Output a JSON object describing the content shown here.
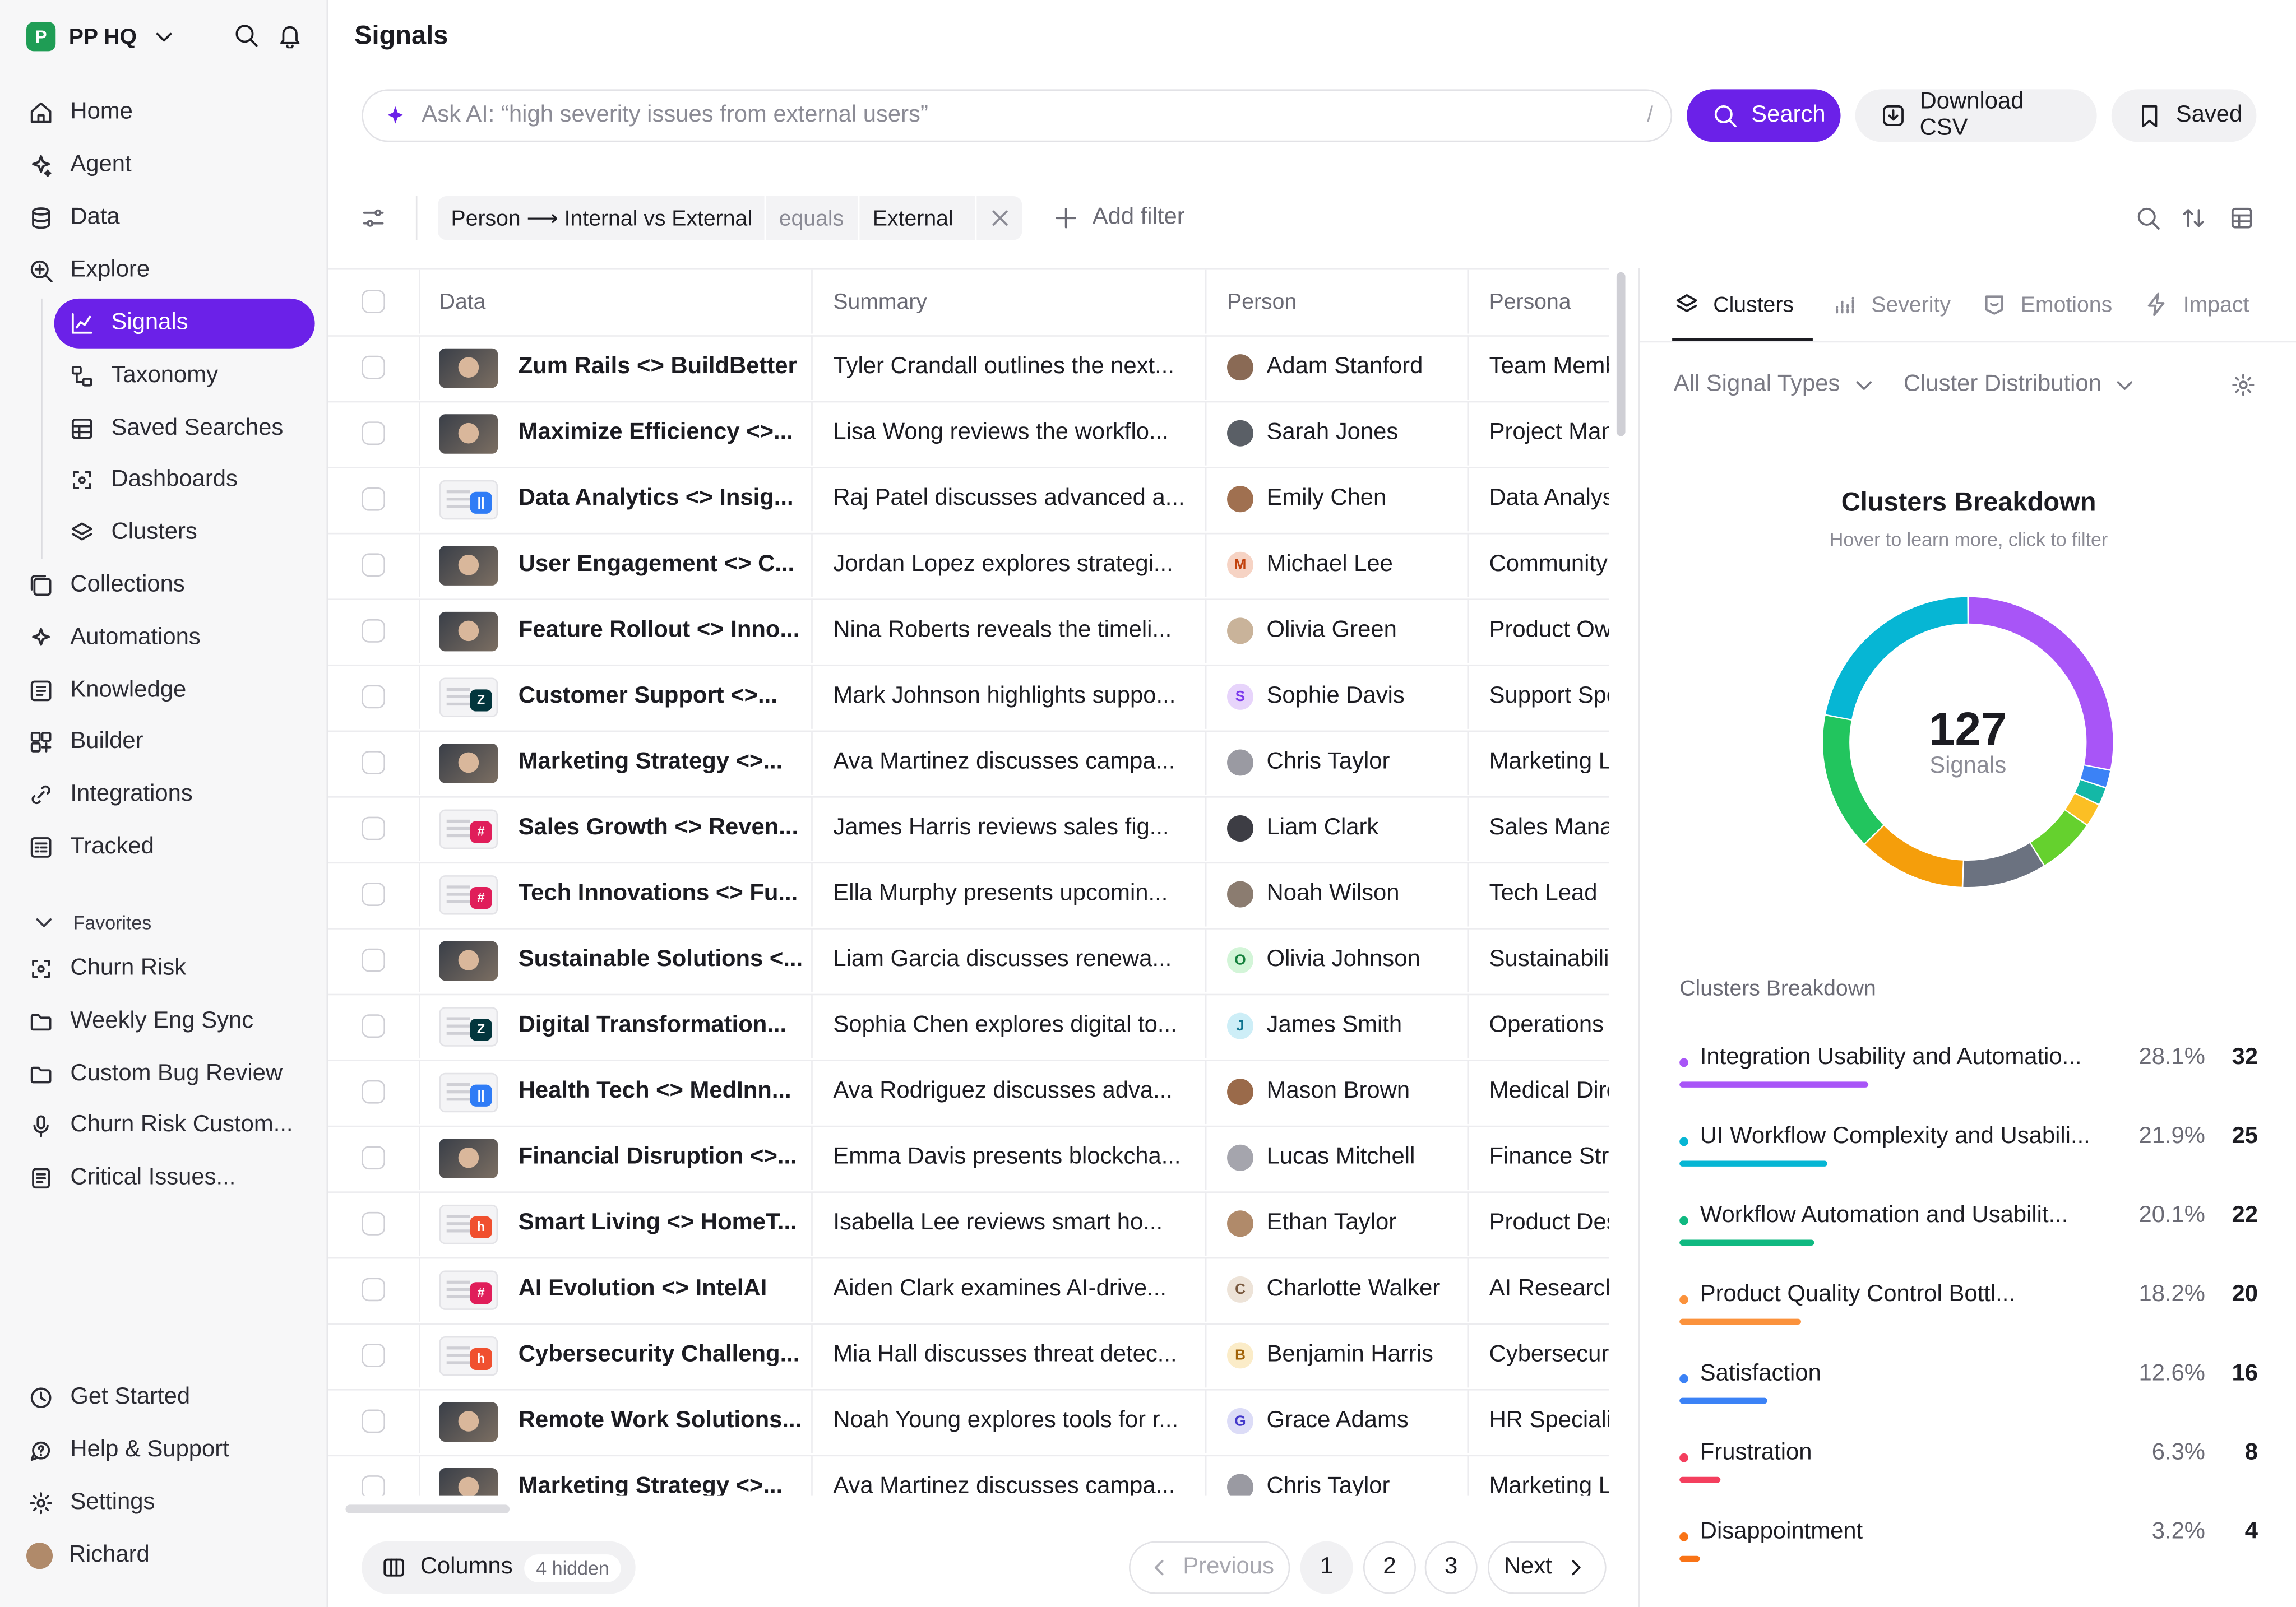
{
  "workspace": {
    "name": "PP HQ",
    "logo_letter": "P"
  },
  "nav": {
    "items": [
      {
        "label": "Home",
        "icon": "home-icon"
      },
      {
        "label": "Agent",
        "icon": "sparkle-icon"
      },
      {
        "label": "Data",
        "icon": "database-icon"
      },
      {
        "label": "Explore",
        "icon": "explore-icon"
      }
    ],
    "sub_items": [
      {
        "label": "Signals",
        "icon": "chart-icon",
        "active": true
      },
      {
        "label": "Taxonomy",
        "icon": "taxonomy-icon"
      },
      {
        "label": "Saved Searches",
        "icon": "table-icon"
      },
      {
        "label": "Dashboards",
        "icon": "dashboard-icon"
      },
      {
        "label": "Clusters",
        "icon": "layers-icon"
      }
    ],
    "items2": [
      {
        "label": "Collections",
        "icon": "collections-icon"
      },
      {
        "label": "Automations",
        "icon": "automation-icon"
      },
      {
        "label": "Knowledge",
        "icon": "knowledge-icon"
      },
      {
        "label": "Builder",
        "icon": "builder-icon"
      },
      {
        "label": "Integrations",
        "icon": "integrations-icon"
      },
      {
        "label": "Tracked",
        "icon": "tracked-icon"
      }
    ],
    "favorites_label": "Favorites",
    "favorites": [
      {
        "label": "Churn Risk",
        "icon": "dashboard-icon"
      },
      {
        "label": "Weekly Eng Sync",
        "icon": "folder-icon"
      },
      {
        "label": "Custom Bug Review",
        "icon": "folder-icon"
      },
      {
        "label": "Churn Risk Custom...",
        "icon": "mic-icon"
      },
      {
        "label": "Critical Issues...",
        "icon": "document-icon"
      }
    ],
    "bottom": [
      {
        "label": "Get Started",
        "icon": "clock-icon"
      },
      {
        "label": "Help & Support",
        "icon": "help-icon"
      },
      {
        "label": "Settings",
        "icon": "gear-icon"
      }
    ],
    "user": "Richard"
  },
  "page": {
    "title": "Signals"
  },
  "search": {
    "placeholder": "Ask AI: “high severity issues from external users”",
    "shortcut": "/",
    "search_label": "Search",
    "download_label": "Download CSV",
    "saved_label": "Saved"
  },
  "filter": {
    "field": "Person ⟶ Internal vs External",
    "operator": "equals",
    "value": "External",
    "add_label": "Add filter"
  },
  "table": {
    "headers": {
      "data": "Data",
      "summary": "Summary",
      "person": "Person",
      "persona": "Persona"
    },
    "rows": [
      {
        "data": "Zum Rails <> BuildBetter",
        "summary": "Tyler Crandall outlines the next...",
        "person": "Adam Stanford",
        "persona": "Team Member",
        "thumb": "video",
        "av": "photo",
        "avc": "#8a6a55",
        "avl": ""
      },
      {
        "data": "Maximize Efficiency <>...",
        "summary": "Lisa Wong reviews the workflo...",
        "person": "Sarah Jones",
        "persona": "Project Manager",
        "thumb": "video",
        "av": "photo",
        "avc": "#5a5f66",
        "avl": ""
      },
      {
        "data": "Data Analytics <> Insig...",
        "summary": "Raj Patel discusses advanced a...",
        "person": "Emily Chen",
        "persona": "Data Analyst",
        "thumb": "doc",
        "tb": "||",
        "tbc": "#2f7cf6",
        "av": "photo",
        "avc": "#a07050",
        "avl": ""
      },
      {
        "data": "User Engagement <> C...",
        "summary": "Jordan Lopez explores strategi...",
        "person": "Michael Lee",
        "persona": "Community Manager",
        "thumb": "video",
        "av": "letter",
        "avc": "#f6d3c4",
        "avt": "#c2410c",
        "avl": "M"
      },
      {
        "data": "Feature Rollout <> Inno...",
        "summary": "Nina Roberts reveals the timeli...",
        "person": "Olivia Green",
        "persona": "Product Owner",
        "thumb": "video",
        "av": "photo",
        "avc": "#c9b39a",
        "avl": ""
      },
      {
        "data": "Customer Support <>...",
        "summary": "Mark Johnson highlights suppo...",
        "person": "Sophie Davis",
        "persona": "Support Specialist",
        "thumb": "doc",
        "tb": "Z",
        "tbc": "#03363d",
        "av": "letter",
        "avc": "#e7d4fb",
        "avt": "#7c3aed",
        "avl": "S"
      },
      {
        "data": "Marketing Strategy <>...",
        "summary": "Ava Martinez discusses campa...",
        "person": "Chris Taylor",
        "persona": "Marketing Lead",
        "thumb": "video",
        "av": "photo",
        "avc": "#9a9aa2",
        "avl": ""
      },
      {
        "data": "Sales Growth <> Reven...",
        "summary": "James Harris reviews sales fig...",
        "person": "Liam Clark",
        "persona": "Sales Manager",
        "thumb": "doc",
        "tb": "#",
        "tbc": "#e01e5a",
        "av": "photo",
        "avc": "#3d3d44",
        "avl": ""
      },
      {
        "data": "Tech Innovations <> Fu...",
        "summary": "Ella Murphy presents upcomin...",
        "person": "Noah Wilson",
        "persona": "Tech Lead",
        "thumb": "doc",
        "tb": "#",
        "tbc": "#e01e5a",
        "av": "photo",
        "avc": "#8b7c70",
        "avl": ""
      },
      {
        "data": "Sustainable Solutions <...",
        "summary": "Liam Garcia discusses renewa...",
        "person": "Olivia Johnson",
        "persona": "Sustainability Lead",
        "thumb": "video",
        "av": "letter",
        "avc": "#d3f5d8",
        "avt": "#15803d",
        "avl": "O"
      },
      {
        "data": "Digital Transformation...",
        "summary": "Sophia Chen explores digital to...",
        "person": "James Smith",
        "persona": "Operations Lead",
        "thumb": "doc",
        "tb": "Z",
        "tbc": "#03363d",
        "av": "letter",
        "avc": "#cdeef7",
        "avt": "#0e7490",
        "avl": "J"
      },
      {
        "data": "Health Tech <> MedInn...",
        "summary": "Ava Rodriguez discusses adva...",
        "person": "Mason Brown",
        "persona": "Medical Director",
        "thumb": "doc",
        "tb": "||",
        "tbc": "#2f7cf6",
        "av": "photo",
        "avc": "#9a6a4a",
        "avl": ""
      },
      {
        "data": "Financial Disruption <>...",
        "summary": "Emma Davis presents blockcha...",
        "person": "Lucas Mitchell",
        "persona": "Finance Strategist",
        "thumb": "video",
        "av": "photo",
        "avc": "#a5a5ad",
        "avl": ""
      },
      {
        "data": "Smart Living <> HomeT...",
        "summary": "Isabella Lee reviews smart ho...",
        "person": "Ethan Taylor",
        "persona": "Product Designer",
        "thumb": "doc",
        "tb": "h",
        "tbc": "#f0502f",
        "av": "photo",
        "avc": "#b08a6a",
        "avl": ""
      },
      {
        "data": "AI Evolution <> IntelAI",
        "summary": "Aiden Clark examines AI-drive...",
        "person": "Charlotte Walker",
        "persona": "AI Researcher",
        "thumb": "doc",
        "tb": "#",
        "tbc": "#e01e5a",
        "av": "letter",
        "avc": "#ede3d8",
        "avt": "#78583e",
        "avl": "C"
      },
      {
        "data": "Cybersecurity Challeng...",
        "summary": "Mia Hall discusses threat detec...",
        "person": "Benjamin Harris",
        "persona": "Cybersecurity Analyst",
        "thumb": "doc",
        "tb": "h",
        "tbc": "#f0502f",
        "av": "letter",
        "avc": "#fbecc8",
        "avt": "#a16207",
        "avl": "B"
      },
      {
        "data": "Remote Work Solutions...",
        "summary": "Noah Young explores tools for r...",
        "person": "Grace Adams",
        "persona": "HR Specialist",
        "thumb": "video",
        "av": "letter",
        "avc": "#dcdcf7",
        "avt": "#4338ca",
        "avl": "G"
      },
      {
        "data": "Marketing Strategy <>...",
        "summary": "Ava Martinez discusses campa...",
        "person": "Chris Taylor",
        "persona": "Marketing Lead",
        "thumb": "video",
        "av": "photo",
        "avc": "#9a9aa2",
        "avl": ""
      }
    ]
  },
  "footer": {
    "columns_label": "Columns",
    "hidden_label": "4 hidden",
    "previous_label": "Previous",
    "pages": [
      "1",
      "2",
      "3"
    ],
    "next_label": "Next"
  },
  "panel": {
    "tabs": [
      "Clusters",
      "Severity",
      "Emotions",
      "Impact"
    ],
    "dropdown_types": "All Signal Types",
    "dropdown_dist": "Cluster Distribution",
    "title": "Clusters Breakdown",
    "subtitle": "Hover to learn more, click to filter",
    "total": "127",
    "total_label": "Signals",
    "list_title": "Clusters Breakdown",
    "colors": {
      "accent": "#6b21e8"
    }
  },
  "chart_data": {
    "type": "pie",
    "title": "Clusters Breakdown",
    "segments": [
      {
        "name": "Integration Usability and Automatio...",
        "percent": "28.1%",
        "count": 32,
        "color": "#a855f7",
        "bar": 0.28
      },
      {
        "name": "UI Workflow Complexity and Usabili...",
        "percent": "21.9%",
        "count": 25,
        "color": "#06b6d4",
        "bar": 0.22
      },
      {
        "name": "Workflow Automation and Usabilit...",
        "percent": "20.1%",
        "count": 22,
        "color": "#10b981",
        "bar": 0.2
      },
      {
        "name": "Product Quality Control Bottl...",
        "percent": "18.2%",
        "count": 20,
        "color": "#fb923c",
        "bar": 0.18
      },
      {
        "name": "Satisfaction",
        "percent": "12.6%",
        "count": 16,
        "color": "#3b82f6",
        "bar": 0.13
      },
      {
        "name": "Frustration",
        "percent": "6.3%",
        "count": 8,
        "color": "#f43f5e",
        "bar": 0.06
      },
      {
        "name": "Disappointment",
        "percent": "3.2%",
        "count": 4,
        "color": "#f97316",
        "bar": 0.03
      }
    ],
    "donut_order": [
      {
        "value": 28.1,
        "color": "#a855f7"
      },
      {
        "value": 2.0,
        "color": "#3b82f6"
      },
      {
        "value": 2.0,
        "color": "#14b8a6"
      },
      {
        "value": 2.6,
        "color": "#fbbf24"
      },
      {
        "value": 6.5,
        "color": "#65d12e"
      },
      {
        "value": 9.4,
        "color": "#6b7280"
      },
      {
        "value": 12.0,
        "color": "#f59e0b"
      },
      {
        "value": 15.4,
        "color": "#22c55e"
      },
      {
        "value": 22.0,
        "color": "#06b6d4"
      }
    ]
  }
}
